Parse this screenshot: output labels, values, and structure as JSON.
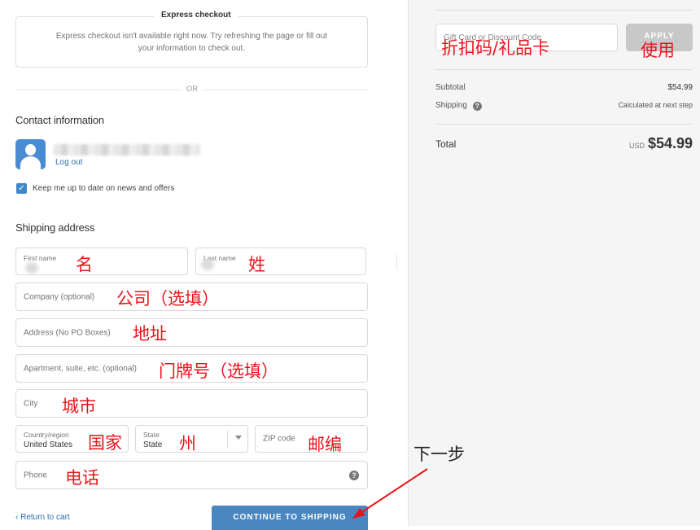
{
  "express": {
    "title": "Express checkout",
    "message_line1": "Express checkout isn't available right now. Try refreshing the page or fill out",
    "message_line2": "your information to check out."
  },
  "divider": {
    "or_text": "OR"
  },
  "contact": {
    "heading": "Contact information",
    "logout": "Log out",
    "newsletter_label": "Keep me up to date on news and offers",
    "newsletter_checked": true
  },
  "shipping": {
    "heading": "Shipping address",
    "first_name_label": "First name",
    "last_name_label": "Last name",
    "company_placeholder": "Company (optional)",
    "address_placeholder": "Address (No PO Boxes)",
    "apartment_placeholder": "Apartment, suite, etc. (optional)",
    "city_placeholder": "City",
    "country_label": "Country/region",
    "country_value": "United States",
    "state_label": "State",
    "state_value": "State",
    "zip_placeholder": "ZIP code",
    "phone_placeholder": "Phone"
  },
  "annotations": {
    "first_name": "名",
    "last_name": "姓",
    "company": "公司（选填）",
    "address": "地址",
    "apartment": "门牌号（选填）",
    "city": "城市",
    "country": "国家",
    "state": "州",
    "zip": "邮编",
    "phone": "电话",
    "next_step": "下一步",
    "gift_code": "折扣码/礼品卡",
    "use": "使用"
  },
  "footer": {
    "back_link": "‹ Return to cart",
    "continue_button": "CONTINUE TO SHIPPING"
  },
  "summary": {
    "gift_placeholder": "Gift Card or Discount Code",
    "apply_button": "APPLY",
    "subtotal_label": "Subtotal",
    "subtotal_value": "$54.99",
    "shipping_label": "Shipping",
    "shipping_value": "Calculated at next step",
    "total_label": "Total",
    "currency": "USD",
    "total_value": "$54.99"
  },
  "colors": {
    "accent_blue": "#4a86c0",
    "link_blue": "#2a6fb1",
    "annotation_red": "#e8141b",
    "summary_bg": "#f5f5f5"
  },
  "icons": [
    "user-avatar-icon",
    "checkbox-check-icon",
    "chevron-down-icon",
    "help-question-icon",
    "arrow-annotation-icon"
  ]
}
